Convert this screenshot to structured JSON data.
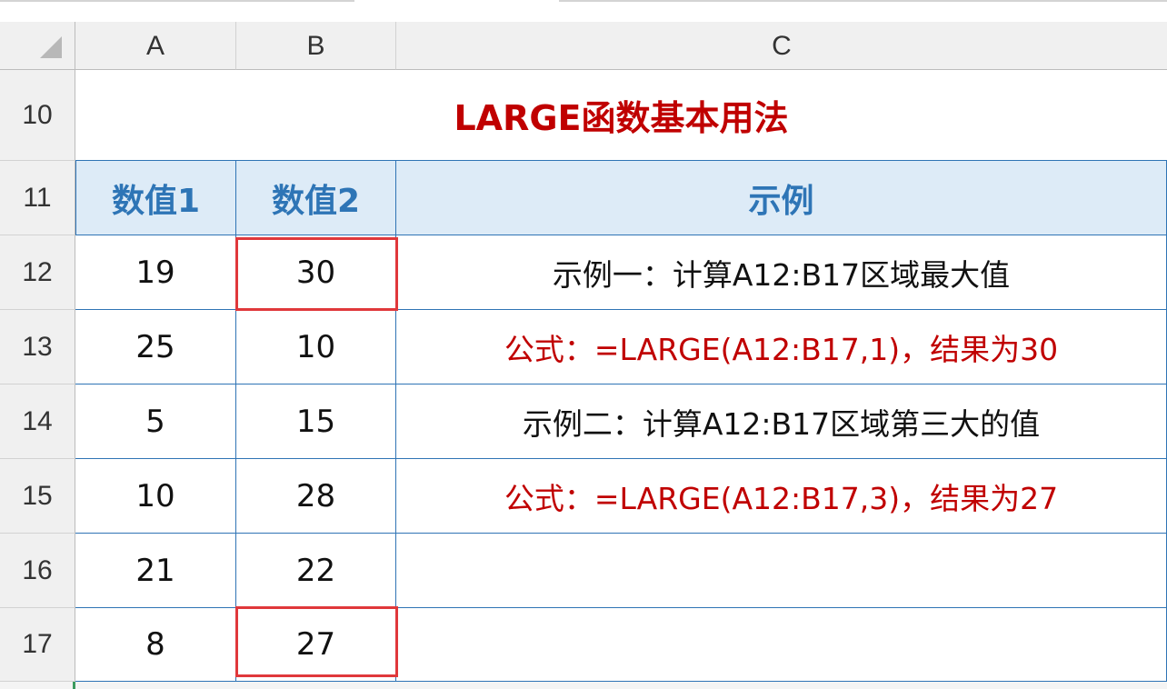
{
  "columns": [
    "A",
    "B",
    "C"
  ],
  "rows": [
    "10",
    "11",
    "12",
    "13",
    "14",
    "15",
    "16",
    "17"
  ],
  "title": "LARGE函数基本用法",
  "headers": {
    "a": "数值1",
    "b": "数值2",
    "c": "示例"
  },
  "data": [
    {
      "a": "19",
      "b": "30",
      "c": "示例一：计算A12:B17区域最大值",
      "c_style": "black"
    },
    {
      "a": "25",
      "b": "10",
      "c": "公式：=LARGE(A12:B17,1)，结果为30",
      "c_style": "red"
    },
    {
      "a": "5",
      "b": "15",
      "c": "示例二：计算A12:B17区域第三大的值",
      "c_style": "black"
    },
    {
      "a": "10",
      "b": "28",
      "c": "公式：=LARGE(A12:B17,3)，结果为27",
      "c_style": "red"
    },
    {
      "a": "21",
      "b": "22",
      "c": ""
    },
    {
      "a": "8",
      "b": "27",
      "c": ""
    }
  ],
  "highlighted_cells": [
    "B12",
    "B17"
  ],
  "colors": {
    "title": "#c00000",
    "header_text": "#2e75b6",
    "header_fill": "#ddebf7",
    "border": "#2f74b5",
    "highlight": "#e0383b"
  }
}
